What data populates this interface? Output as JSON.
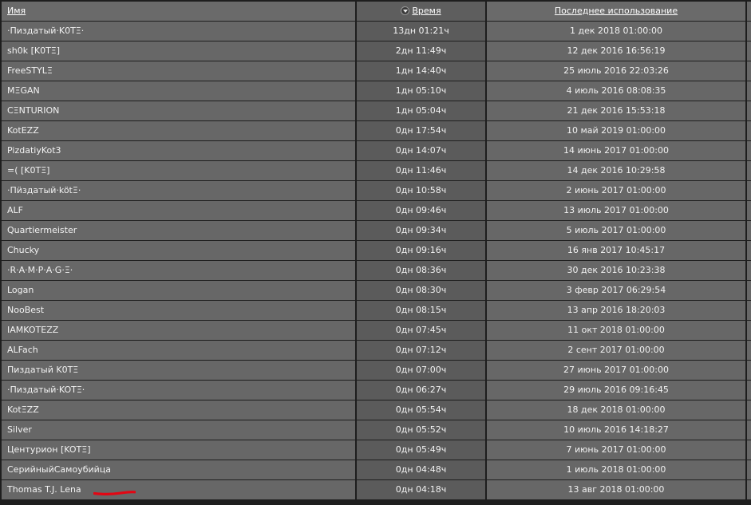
{
  "table": {
    "headers": {
      "name": "Имя",
      "time": "Время",
      "last_used": "Последнее использование"
    },
    "rows": [
      {
        "name": "·Пиздатый·K0TΞ·",
        "time": "13дн 01:21ч",
        "last": "1 дек 2018 01:00:00"
      },
      {
        "name": "sh0k [K0TΞ]",
        "time": "2дн 11:49ч",
        "last": "12 дек 2016 16:56:19"
      },
      {
        "name": "FreeSTYLΞ",
        "time": "1дн 14:40ч",
        "last": "25 июль 2016 22:03:26"
      },
      {
        "name": "MΞGAN",
        "time": "1дн 05:10ч",
        "last": "4 июль 2016 08:08:35"
      },
      {
        "name": "CΞNTURION",
        "time": "1дн 05:04ч",
        "last": "21 дек 2016 15:53:18"
      },
      {
        "name": "KotEZZ",
        "time": "0дн 17:54ч",
        "last": "10 май 2019 01:00:00"
      },
      {
        "name": "PizdatiyKot3",
        "time": "0дн 14:07ч",
        "last": "14 июнь 2017 01:00:00"
      },
      {
        "name": "=( [K0TΞ]",
        "time": "0дн 11:46ч",
        "last": "14 дек 2016 10:29:58"
      },
      {
        "name": "·Пӥздатый·kötΞ·",
        "time": "0дн 10:58ч",
        "last": "2 июнь 2017 01:00:00"
      },
      {
        "name": "ALF",
        "time": "0дн 09:46ч",
        "last": "13 июль 2017 01:00:00"
      },
      {
        "name": "Quartiermeister",
        "time": "0дн 09:34ч",
        "last": "5 июль 2017 01:00:00"
      },
      {
        "name": "Chucky",
        "time": "0дн 09:16ч",
        "last": "16 янв 2017 10:45:17"
      },
      {
        "name": "·R·A·M·P·A·G·Ξ·",
        "time": "0дн 08:36ч",
        "last": "30 дек 2016 10:23:38"
      },
      {
        "name": "Logan",
        "time": "0дн 08:30ч",
        "last": "3 февр 2017 06:29:54"
      },
      {
        "name": "NooBest",
        "time": "0дн 08:15ч",
        "last": "13 апр 2016 18:20:03"
      },
      {
        "name": "IAMKOTEZZ",
        "time": "0дн 07:45ч",
        "last": "11 окт 2018 01:00:00"
      },
      {
        "name": "ALFach",
        "time": "0дн 07:12ч",
        "last": "2 сент 2017 01:00:00"
      },
      {
        "name": "Пиздатый K0TΞ",
        "time": "0дн 07:00ч",
        "last": "27 июнь 2017 01:00:00"
      },
      {
        "name": "·Пиздатый·KOTΞ·",
        "time": "0дн 06:27ч",
        "last": "29 июль 2016 09:16:45"
      },
      {
        "name": "KotΞZZ",
        "time": "0дн 05:54ч",
        "last": "18 дек 2018 01:00:00"
      },
      {
        "name": "Silver",
        "time": "0дн 05:52ч",
        "last": "10 июль 2016 14:18:27"
      },
      {
        "name": "Центурион [KOTΞ]",
        "time": "0дн 05:49ч",
        "last": "7 июнь 2017 01:00:00"
      },
      {
        "name": "СерийныйСамоубийца",
        "time": "0дн 04:48ч",
        "last": "1 июль 2018 01:00:00"
      },
      {
        "name": "Thomas T.J. Lena",
        "time": "0дн 04:18ч",
        "last": "13 авг 2018 01:00:00"
      }
    ]
  },
  "colors": {
    "cell_bg": "#676767",
    "sorted_col_bg": "#5b5b5b",
    "grid_line": "#1e1e1e",
    "text": "#f2f2f2",
    "annotation_mark": "#e30613"
  },
  "icons": {
    "sort": "sort-descending-icon"
  }
}
